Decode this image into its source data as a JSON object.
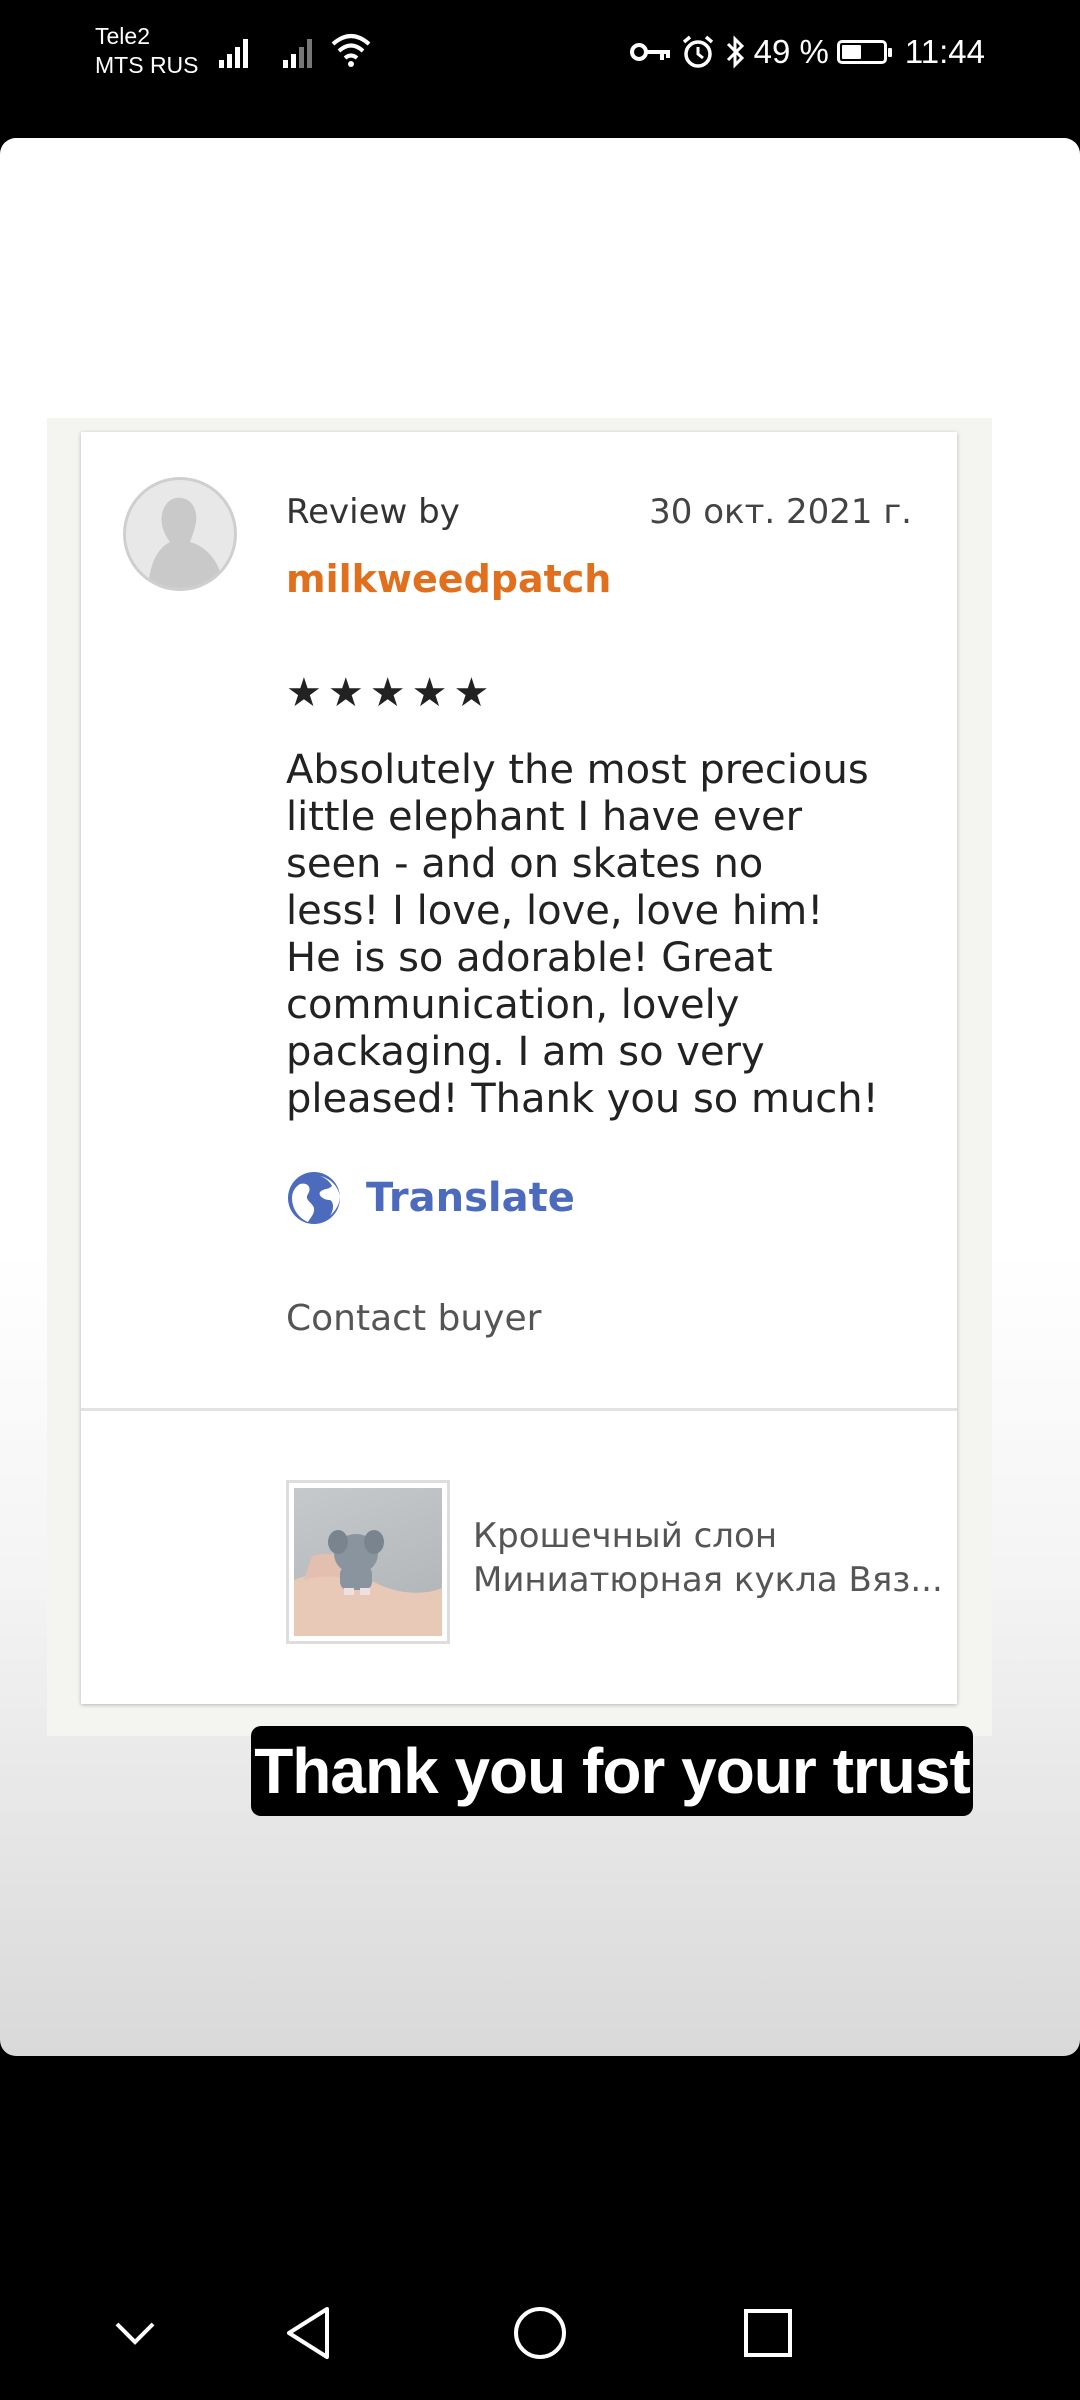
{
  "status_bar": {
    "carrier_1": "Tele2",
    "carrier_2": "MTS RUS",
    "battery_text": "49 %",
    "battery_level": 0.49,
    "time": "11:44"
  },
  "review": {
    "review_by_label": "Review by",
    "date": "30 окт. 2021 г.",
    "username": "milkweedpatch",
    "rating": 5,
    "stars": "★★★★★",
    "text": "Absolutely the most precious\nlittle elephant I have ever\nseen - and on skates no\nless!  I love, love, love him!\nHe is so adorable!  Great\ncommunication, lovely\npackaging.  I am so very\npleased!  Thank you so much!",
    "translate_label": "Translate",
    "contact_label": "Contact buyer"
  },
  "item": {
    "title_line1": "Крошечный слон",
    "title_line2": "Миниатюрная кукла Вяз..."
  },
  "caption": "Thank you for your trust",
  "colors": {
    "username": "#e0701d",
    "translate": "#4d6bbd",
    "caption_bg": "#000000"
  },
  "nav_icons": [
    "chevron-down-icon",
    "back-icon",
    "home-icon",
    "recents-icon"
  ]
}
